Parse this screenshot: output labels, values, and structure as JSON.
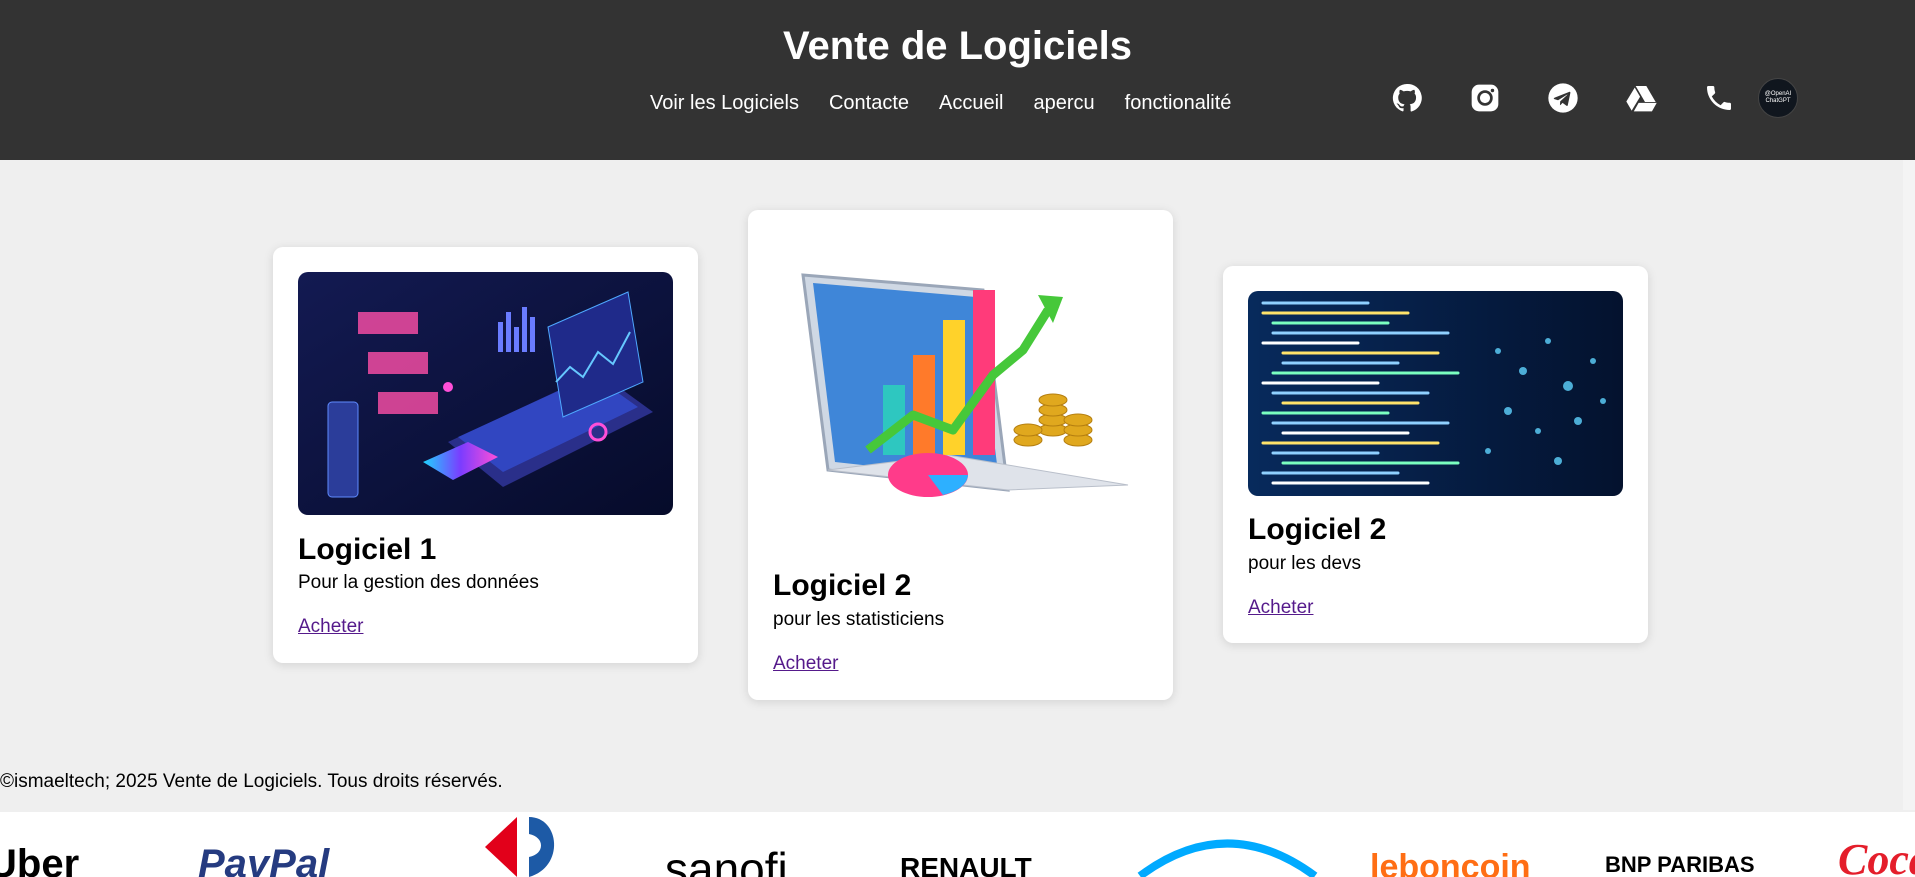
{
  "header": {
    "title": "Vente de Logiciels",
    "nav": [
      "Voir les Logiciels",
      "Contacte",
      "Accueil",
      "apercu",
      "fonctionalité"
    ],
    "social_icons": [
      "github-icon",
      "instagram-icon",
      "telegram-icon",
      "google-drive-icon",
      "phone-icon"
    ],
    "avatar_text": [
      "@OpenAI",
      "ChatGPT"
    ]
  },
  "cards": [
    {
      "title": "Logiciel 1",
      "desc": "Pour la gestion des données",
      "link": "Acheter"
    },
    {
      "title": "Logiciel 2",
      "desc": "pour les statisticiens",
      "link": "Acheter"
    },
    {
      "title": "Logiciel 2",
      "desc": "pour les devs",
      "link": "Acheter"
    }
  ],
  "footer": {
    "copyright": "©ismaeltech; 2025 Vente de Logiciels. Tous droits réservés."
  },
  "partners": [
    "Uber",
    "PayPal",
    "Carrefour",
    "sanofi",
    "RENAULT",
    "engie",
    "leboncoin",
    "BNP PARIBAS",
    "Coca-Cola"
  ],
  "colors": {
    "header_bg": "#333333",
    "page_bg": "#efefef",
    "link": "#551a8b"
  }
}
